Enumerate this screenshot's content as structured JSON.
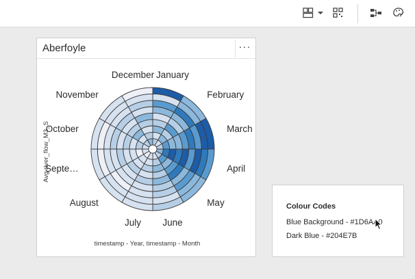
{
  "toolbar": {
    "icons": [
      "dashboard-layout-icon",
      "caret-down-icon",
      "qr-grid-icon",
      "node-tree-icon",
      "palette-icon"
    ]
  },
  "card": {
    "title": "Aberfoyle",
    "menu_label": "···"
  },
  "chart_data": {
    "type": "heatmap",
    "layout": "radial",
    "categories": [
      "January",
      "February",
      "March",
      "April",
      "May",
      "June",
      "July",
      "August",
      "Septe…",
      "October",
      "November",
      "December"
    ],
    "ring_count": 9,
    "ylabel": "Avg river_flow_M3_S",
    "xlabel": "timestamp - Year, timestamp - Month",
    "values": [
      [
        2,
        1,
        3,
        2,
        1,
        3,
        4,
        1,
        6
      ],
      [
        1,
        3,
        2,
        4,
        2,
        3,
        5,
        3,
        3
      ],
      [
        2,
        4,
        3,
        3,
        4,
        5,
        4,
        6,
        6
      ],
      [
        3,
        5,
        6,
        5,
        6,
        4,
        6,
        5,
        4
      ],
      [
        2,
        4,
        3,
        4,
        5,
        3,
        4,
        3,
        3
      ],
      [
        1,
        2,
        3,
        2,
        3,
        2,
        2,
        1,
        2
      ],
      [
        1,
        1,
        2,
        1,
        2,
        1,
        1,
        1,
        1
      ],
      [
        0,
        1,
        1,
        2,
        1,
        1,
        0,
        1,
        1
      ],
      [
        1,
        0,
        1,
        1,
        2,
        1,
        1,
        0,
        1
      ],
      [
        1,
        2,
        1,
        2,
        1,
        2,
        1,
        0,
        1
      ],
      [
        2,
        1,
        3,
        2,
        1,
        2,
        1,
        1,
        1
      ],
      [
        3,
        2,
        1,
        2,
        3,
        1,
        2,
        1,
        0
      ]
    ],
    "scale_colors": [
      "#eef0f8",
      "#d6e2f0",
      "#b6cfe6",
      "#8cb8dc",
      "#5a9bcf",
      "#2f79bd",
      "#1d5ca7"
    ]
  },
  "colour_panel": {
    "title": "Colour Codes",
    "lines": [
      "Blue Background - #1D6AA0",
      "Dark Blue - #204E7B"
    ]
  }
}
